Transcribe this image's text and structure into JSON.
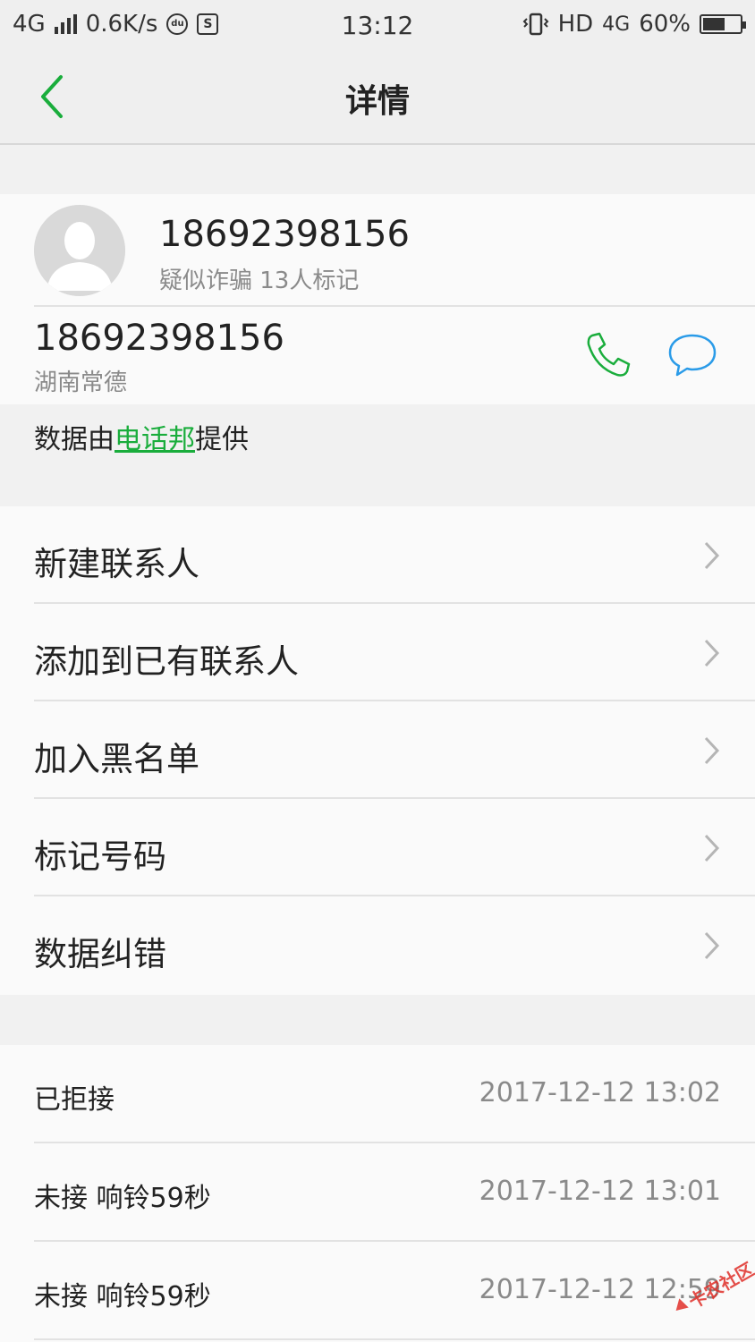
{
  "status_bar": {
    "network": "4G",
    "speed": "0.6K/s",
    "app_icon_1": "du-icon",
    "app_icon_2": "S",
    "time": "13:12",
    "hd": "HD",
    "network_right": "4G",
    "battery_percent": "60%",
    "battery_level": 0.6
  },
  "nav": {
    "title": "详情"
  },
  "contact": {
    "name": "18692398156",
    "tag": "疑似诈骗 13人标记",
    "number": "18692398156",
    "region": "湖南常德"
  },
  "provider": {
    "prefix": "数据由",
    "link": "电话邦",
    "suffix": "提供"
  },
  "menu": {
    "items": [
      {
        "label": "新建联系人"
      },
      {
        "label": "添加到已有联系人"
      },
      {
        "label": "加入黑名单"
      },
      {
        "label": "标记号码"
      },
      {
        "label": "数据纠错"
      }
    ]
  },
  "call_log": {
    "items": [
      {
        "status": "已拒接",
        "time": "2017-12-12 13:02"
      },
      {
        "status": "未接 响铃59秒",
        "time": "2017-12-12 13:01"
      },
      {
        "status": "未接 响铃59秒",
        "time": "2017-12-12 12:59"
      }
    ]
  },
  "colors": {
    "accent_green": "#1aad3c",
    "message_blue": "#2a9be8",
    "background": "#f1f1f1"
  }
}
